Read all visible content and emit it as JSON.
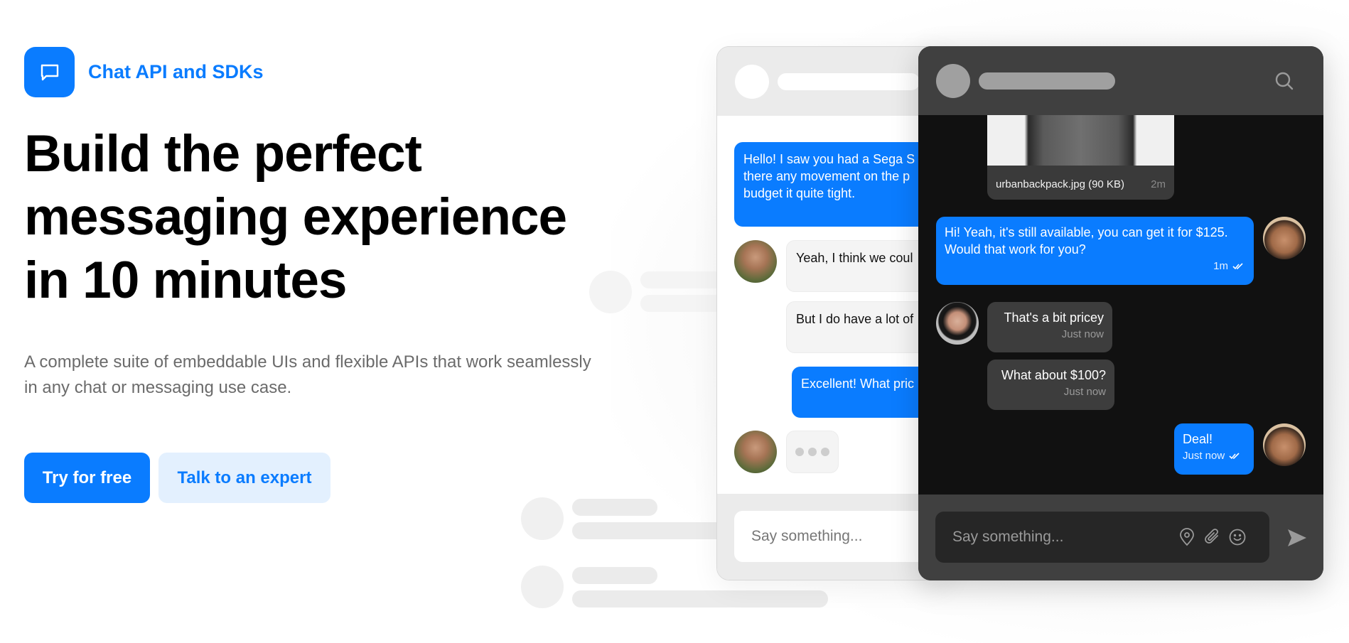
{
  "brand": {
    "name": "Chat API and SDKs",
    "icon": "chat-bubble-icon",
    "accent_color": "#0a7cff"
  },
  "hero": {
    "headline_lines": [
      "Build the perfect",
      "messaging experience",
      "in 10 minutes"
    ],
    "subtitle_lines": [
      "A complete suite of embeddable UIs and flexible APIs that work seamlessly",
      "in any chat or messaging use case."
    ],
    "primary_cta": "Try for free",
    "secondary_cta": "Talk to an expert"
  },
  "light_chat": {
    "messages": [
      {
        "direction": "outgoing",
        "text_lines": [
          "Hello! I saw you had a Sega S",
          "there any movement on the p",
          "budget it quite tight."
        ]
      },
      {
        "direction": "incoming",
        "text": "Yeah, I think we coul"
      },
      {
        "direction": "incoming",
        "text": "But I do have a lot of"
      },
      {
        "direction": "outgoing",
        "text": "Excellent! What pric"
      },
      {
        "direction": "incoming",
        "typing": true
      }
    ],
    "input_placeholder": "Say something..."
  },
  "dark_chat": {
    "attachment": {
      "filename": "urbanbackpack.jpg (90 KB)",
      "time": "2m"
    },
    "messages": [
      {
        "direction": "outgoing",
        "text_lines": [
          "Hi! Yeah, it's still available, you can get it for $125.",
          "Would that work for you?"
        ],
        "time": "1m",
        "status": "read"
      },
      {
        "direction": "incoming",
        "text": "That's a bit pricey",
        "time": "Just now"
      },
      {
        "direction": "incoming",
        "text": "What about $100?",
        "time": "Just now"
      },
      {
        "direction": "outgoing",
        "text": "Deal!",
        "time": "Just now",
        "status": "read"
      }
    ],
    "input_placeholder": "Say something...",
    "icons": [
      "search-icon",
      "location-pin-icon",
      "paperclip-icon",
      "emoji-icon",
      "send-icon"
    ]
  }
}
